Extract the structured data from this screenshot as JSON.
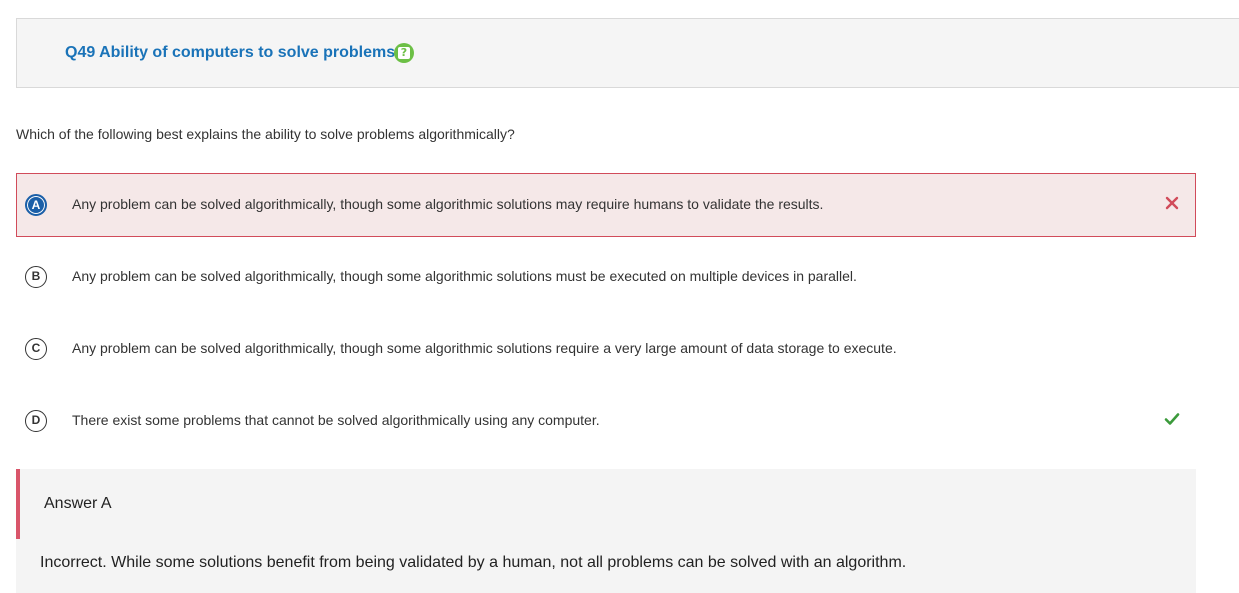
{
  "header": {
    "question_title": "Q49 Ability of computers to solve problems",
    "help_icon": "help-icon"
  },
  "question": {
    "text": "Which of the following best explains the ability to solve problems algorithmically?"
  },
  "options": [
    {
      "letter": "A",
      "text": "Any problem can be solved algorithmically, though some algorithmic solutions may require humans to validate the results.",
      "selected": true,
      "status": "incorrect",
      "status_icon": "x-icon"
    },
    {
      "letter": "B",
      "text": "Any problem can be solved algorithmically, though some algorithmic solutions must be executed on multiple devices in parallel.",
      "selected": false
    },
    {
      "letter": "C",
      "text": "Any problem can be solved algorithmically, though some algorithmic solutions require a very large amount of data storage to execute.",
      "selected": false
    },
    {
      "letter": "D",
      "text": "There exist some problems that cannot be solved algorithmically using any computer.",
      "selected": false,
      "status": "correct",
      "status_icon": "checkmark-icon"
    }
  ],
  "feedback": {
    "title": "Answer A",
    "text": "Incorrect. While some solutions benefit from being validated by a human, not all problems can be solved with an algorithm."
  },
  "colors": {
    "title_blue": "#1a73b8",
    "help_green": "#6cbf45",
    "selected_bg": "#f5e8e8",
    "selected_border": "#d14b5a",
    "letter_selected_bg": "#1b5fa8",
    "incorrect_red": "#d14b5a",
    "correct_green": "#3b9a3b",
    "feedback_bar": "#d9556a"
  }
}
